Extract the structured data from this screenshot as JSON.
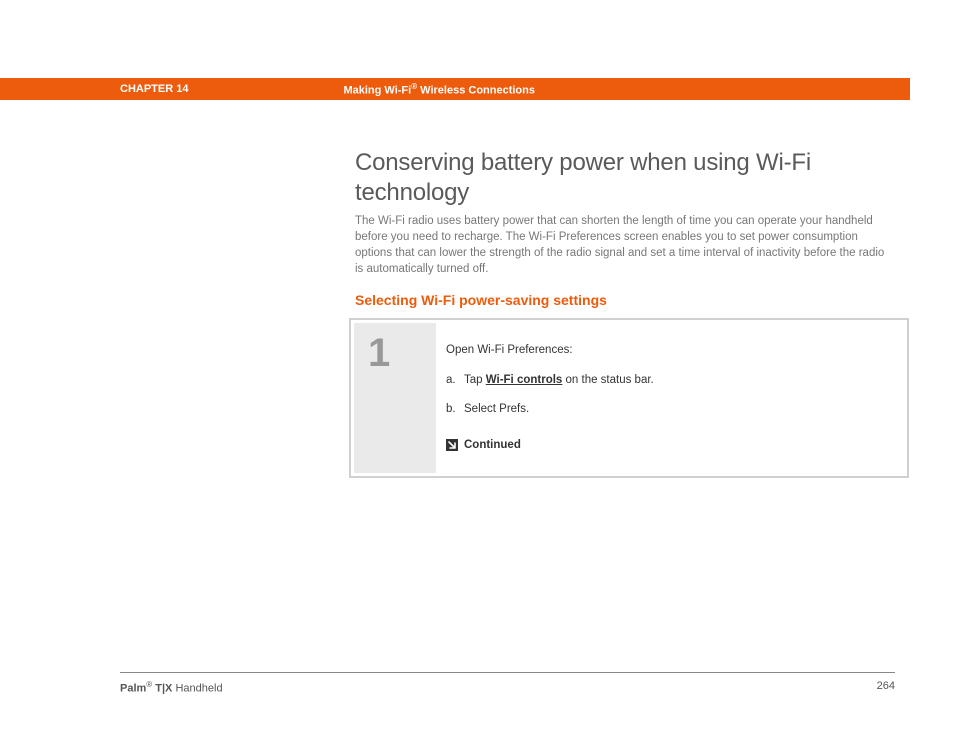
{
  "header": {
    "chapter_label": "CHAPTER 14",
    "title_prefix": "Making Wi-Fi",
    "title_suffix": " Wireless Connections",
    "reg_mark": "®"
  },
  "main": {
    "title": "Conserving battery power when using Wi-Fi technology",
    "paragraph": "The Wi-Fi radio uses battery power that can shorten the length of time you can operate your handheld before you need to recharge. The Wi-Fi Preferences screen enables you to set power consumption options that can lower the strength of the radio signal and set a time interval of inactivity before the radio is automatically turned off.",
    "subhead": "Selecting Wi-Fi power-saving settings"
  },
  "step": {
    "number": "1",
    "intro": "Open Wi-Fi Preferences:",
    "a_letter": "a.",
    "a_pre": "Tap ",
    "a_link": "Wi-Fi controls",
    "a_post": " on the status bar.",
    "b_letter": "b.",
    "b_text": "Select Prefs.",
    "continued": "Continued"
  },
  "footer": {
    "brand_a": "Palm",
    "reg_mark": "®",
    "brand_b": " T|X",
    "brand_c": " Handheld",
    "page_number": "264"
  }
}
